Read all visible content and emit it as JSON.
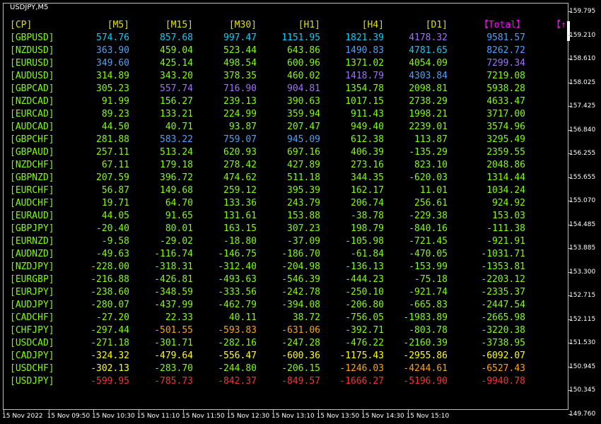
{
  "window": {
    "title": "USDJPY,M5"
  },
  "colors": {
    "header": "#e0e000",
    "symbol": "#7fff00",
    "total_header": "#ff00ff",
    "cyan": "#00d0ff",
    "blue": "#4aa3ff",
    "purple": "#a070ff",
    "green": "#7fff00",
    "orange": "#ffa500",
    "yellow": "#ffff00",
    "red": "#ff3030"
  },
  "table": {
    "headers": {
      "cp": "[CP]",
      "m5": "[M5]",
      "m15": "[M15]",
      "m30": "[M30]",
      "h1": "[H1]",
      "h4": "[H4]",
      "d1": "[D1]",
      "total": "【Total】",
      "extra": "【↑"
    },
    "rows": [
      {
        "symbol": "[GBPUSD]",
        "m5": "574.76",
        "m15": "857.68",
        "m30": "997.47",
        "h1": "1151.95",
        "h4": "1821.39",
        "d1": "4178.32",
        "total": "9581.57"
      },
      {
        "symbol": "[NZDUSD]",
        "m5": "363.90",
        "m15": "459.04",
        "m30": "523.44",
        "h1": "643.86",
        "h4": "1490.83",
        "d1": "4781.65",
        "total": "8262.72"
      },
      {
        "symbol": "[EURUSD]",
        "m5": "349.60",
        "m15": "425.14",
        "m30": "498.54",
        "h1": "600.96",
        "h4": "1371.02",
        "d1": "4054.09",
        "total": "7299.34"
      },
      {
        "symbol": "[AUDUSD]",
        "m5": "314.89",
        "m15": "343.20",
        "m30": "378.35",
        "h1": "460.02",
        "h4": "1418.79",
        "d1": "4303.84",
        "total": "7219.08"
      },
      {
        "symbol": "[GBPCAD]",
        "m5": "305.23",
        "m15": "557.74",
        "m30": "716.90",
        "h1": "904.81",
        "h4": "1354.78",
        "d1": "2098.81",
        "total": "5938.28"
      },
      {
        "symbol": "[NZDCAD]",
        "m5": "91.99",
        "m15": "156.27",
        "m30": "239.13",
        "h1": "390.63",
        "h4": "1017.15",
        "d1": "2738.29",
        "total": "4633.47"
      },
      {
        "symbol": "[EURCAD]",
        "m5": "89.23",
        "m15": "133.21",
        "m30": "224.99",
        "h1": "359.94",
        "h4": "911.43",
        "d1": "1998.21",
        "total": "3717.00"
      },
      {
        "symbol": "[AUDCAD]",
        "m5": "44.50",
        "m15": "40.71",
        "m30": "93.87",
        "h1": "207.47",
        "h4": "949.40",
        "d1": "2239.01",
        "total": "3574.96"
      },
      {
        "symbol": "[GBPCHF]",
        "m5": "281.88",
        "m15": "583.22",
        "m30": "759.07",
        "h1": "945.09",
        "h4": "612.38",
        "d1": "113.87",
        "total": "3295.49"
      },
      {
        "symbol": "[GBPAUD]",
        "m5": "257.11",
        "m15": "513.24",
        "m30": "620.93",
        "h1": "697.16",
        "h4": "406.39",
        "d1": "-135.29",
        "total": "2359.55"
      },
      {
        "symbol": "[NZDCHF]",
        "m5": "67.11",
        "m15": "179.18",
        "m30": "278.42",
        "h1": "427.89",
        "h4": "273.16",
        "d1": "823.10",
        "total": "2048.86"
      },
      {
        "symbol": "[GBPNZD]",
        "m5": "207.59",
        "m15": "396.72",
        "m30": "474.62",
        "h1": "511.18",
        "h4": "344.35",
        "d1": "-620.03",
        "total": "1314.44"
      },
      {
        "symbol": "[EURCHF]",
        "m5": "56.87",
        "m15": "149.68",
        "m30": "259.12",
        "h1": "395.39",
        "h4": "162.17",
        "d1": "11.01",
        "total": "1034.24"
      },
      {
        "symbol": "[AUDCHF]",
        "m5": "19.71",
        "m15": "64.70",
        "m30": "133.36",
        "h1": "243.79",
        "h4": "206.74",
        "d1": "256.61",
        "total": "924.92"
      },
      {
        "symbol": "[EURAUD]",
        "m5": "44.05",
        "m15": "91.65",
        "m30": "131.61",
        "h1": "153.88",
        "h4": "-38.78",
        "d1": "-229.38",
        "total": "153.03"
      },
      {
        "symbol": "[GBPJPY]",
        "m5": "-20.40",
        "m15": "80.01",
        "m30": "163.15",
        "h1": "307.23",
        "h4": "198.79",
        "d1": "-840.16",
        "total": "-111.38"
      },
      {
        "symbol": "[EURNZD]",
        "m5": "-9.58",
        "m15": "-29.02",
        "m30": "-18.80",
        "h1": "-37.09",
        "h4": "-105.98",
        "d1": "-721.45",
        "total": "-921.91"
      },
      {
        "symbol": "[AUDNZD]",
        "m5": "-49.63",
        "m15": "-116.74",
        "m30": "-146.75",
        "h1": "-186.70",
        "h4": "-61.84",
        "d1": "-470.05",
        "total": "-1031.71"
      },
      {
        "symbol": "[NZDJPY]",
        "m5": "-228.00",
        "m15": "-318.31",
        "m30": "-312.40",
        "h1": "-204.98",
        "h4": "-136.13",
        "d1": "-153.99",
        "total": "-1353.81"
      },
      {
        "symbol": "[EURGBP]",
        "m5": "-216.88",
        "m15": "-426.81",
        "m30": "-493.63",
        "h1": "-546.39",
        "h4": "-444.23",
        "d1": "-75.18",
        "total": "-2203.12"
      },
      {
        "symbol": "[EURJPY]",
        "m5": "-238.60",
        "m15": "-348.59",
        "m30": "-333.56",
        "h1": "-242.78",
        "h4": "-250.10",
        "d1": "-921.74",
        "total": "-2335.37"
      },
      {
        "symbol": "[AUDJPY]",
        "m5": "-280.07",
        "m15": "-437.99",
        "m30": "-462.79",
        "h1": "-394.08",
        "h4": "-206.80",
        "d1": "-665.83",
        "total": "-2447.54"
      },
      {
        "symbol": "[CADCHF]",
        "m5": "-27.20",
        "m15": "22.33",
        "m30": "40.11",
        "h1": "38.72",
        "h4": "-756.05",
        "d1": "-1983.89",
        "total": "-2665.98"
      },
      {
        "symbol": "[CHFJPY]",
        "m5": "-297.44",
        "m15": "-501.55",
        "m30": "-593.83",
        "h1": "-631.06",
        "h4": "-392.71",
        "d1": "-803.78",
        "total": "-3220.38"
      },
      {
        "symbol": "[USDCAD]",
        "m5": "-271.18",
        "m15": "-301.71",
        "m30": "-282.16",
        "h1": "-247.28",
        "h4": "-476.22",
        "d1": "-2160.39",
        "total": "-3738.95"
      },
      {
        "symbol": "[CADJPY]",
        "m5": "-324.32",
        "m15": "-479.64",
        "m30": "-556.47",
        "h1": "-600.36",
        "h4": "-1175.43",
        "d1": "-2955.86",
        "total": "-6092.07"
      },
      {
        "symbol": "[USDCHF]",
        "m5": "-302.13",
        "m15": "-283.70",
        "m30": "-244.80",
        "h1": "-206.15",
        "h4": "-1246.03",
        "d1": "-4244.61",
        "total": "-6527.43"
      },
      {
        "symbol": "[USDJPY]",
        "m5": "-599.95",
        "m15": "-785.73",
        "m30": "-842.37",
        "h1": "-849.57",
        "h4": "-1666.27",
        "d1": "-5196.90",
        "total": "-9940.78"
      }
    ],
    "cell_colors": {
      "m5": [
        "cyan",
        "blue",
        "blue",
        "green",
        "green",
        "green",
        "green",
        "green",
        "green",
        "green",
        "green",
        "green",
        "green",
        "green",
        "green",
        "green",
        "green",
        "green",
        "green",
        "green",
        "green",
        "green",
        "green",
        "green",
        "green",
        "yellow",
        "yellow",
        "red"
      ],
      "m15": [
        "cyan",
        "green",
        "green",
        "green",
        "purple",
        "green",
        "green",
        "green",
        "blue",
        "green",
        "green",
        "green",
        "green",
        "green",
        "green",
        "green",
        "green",
        "green",
        "green",
        "green",
        "green",
        "green",
        "green",
        "orange",
        "green",
        "yellow",
        "green",
        "red"
      ],
      "m30": [
        "cyan",
        "green",
        "green",
        "green",
        "purple",
        "green",
        "green",
        "green",
        "blue",
        "green",
        "green",
        "green",
        "green",
        "green",
        "green",
        "green",
        "green",
        "green",
        "green",
        "green",
        "green",
        "green",
        "green",
        "orange",
        "green",
        "yellow",
        "green",
        "red"
      ],
      "h1": [
        "cyan",
        "green",
        "green",
        "green",
        "purple",
        "green",
        "green",
        "green",
        "blue",
        "green",
        "green",
        "green",
        "green",
        "green",
        "green",
        "green",
        "green",
        "green",
        "green",
        "green",
        "green",
        "green",
        "green",
        "orange",
        "green",
        "yellow",
        "green",
        "red"
      ],
      "h4": [
        "cyan",
        "blue",
        "green",
        "purple",
        "green",
        "green",
        "green",
        "green",
        "green",
        "green",
        "green",
        "green",
        "green",
        "green",
        "green",
        "green",
        "green",
        "green",
        "green",
        "green",
        "green",
        "green",
        "green",
        "green",
        "green",
        "yellow",
        "orange",
        "red"
      ],
      "d1": [
        "purple",
        "cyan",
        "green",
        "blue",
        "green",
        "green",
        "green",
        "green",
        "green",
        "green",
        "green",
        "green",
        "green",
        "green",
        "green",
        "green",
        "green",
        "green",
        "green",
        "green",
        "green",
        "green",
        "green",
        "green",
        "green",
        "yellow",
        "orange",
        "red"
      ],
      "total": [
        "blue",
        "blue",
        "purple",
        "green",
        "green",
        "green",
        "green",
        "green",
        "green",
        "green",
        "green",
        "green",
        "green",
        "green",
        "green",
        "green",
        "green",
        "green",
        "green",
        "green",
        "green",
        "green",
        "green",
        "green",
        "green",
        "yellow",
        "orange",
        "red"
      ]
    }
  },
  "price_axis": [
    "159.795",
    "159.210",
    "158.610",
    "158.025",
    "157.425",
    "156.840",
    "156.255",
    "155.655",
    "155.070",
    "154.485",
    "153.885",
    "153.300",
    "152.715",
    "152.115",
    "151.530",
    "150.945",
    "150.345",
    "149.760"
  ],
  "time_axis": [
    "15 Nov 2022",
    "15 Nov 09:50",
    "15 Nov 10:30",
    "15 Nov 11:10",
    "15 Nov 11:50",
    "15 Nov 12:30",
    "15 Nov 13:10",
    "15 Nov 13:50",
    "15 Nov 14:30",
    "15 Nov 15:10"
  ]
}
